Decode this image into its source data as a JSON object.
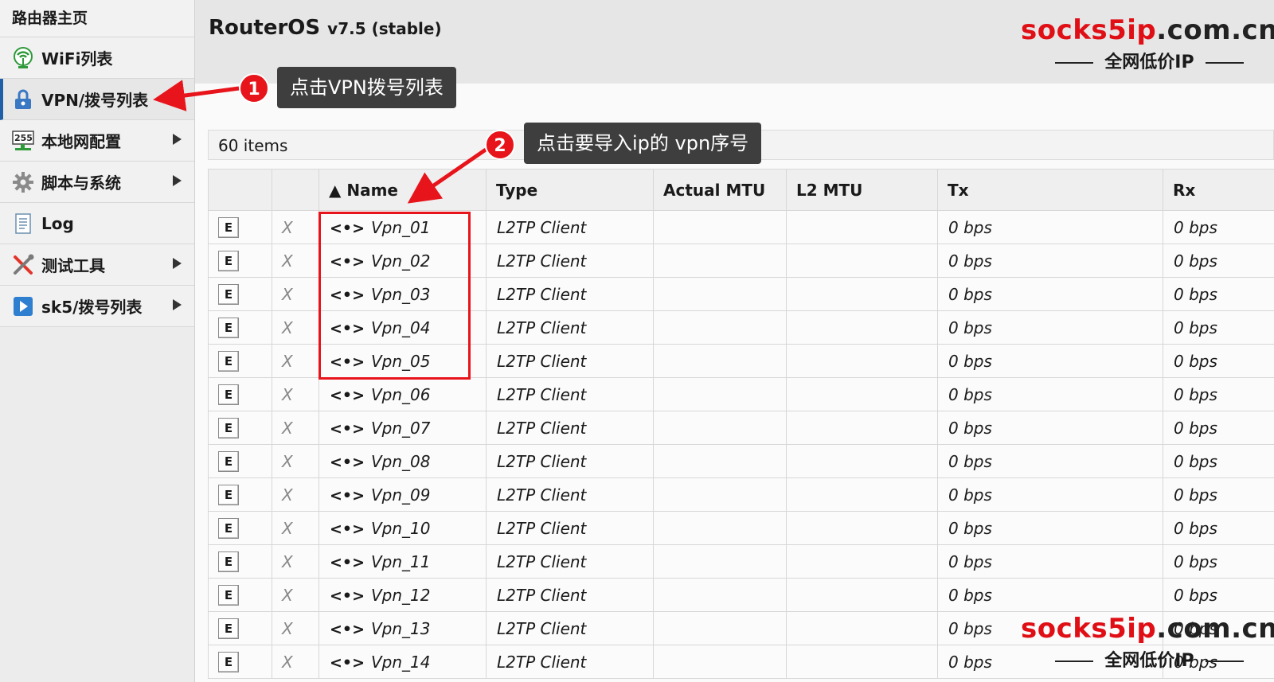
{
  "sidebar": {
    "home": "路由器主页",
    "items": [
      {
        "label": "WiFi列表",
        "icon": "wifi-icon",
        "active": false,
        "submenu": false
      },
      {
        "label": "VPN/拨号列表",
        "icon": "vpn-lock-icon",
        "active": true,
        "submenu": false
      },
      {
        "label": "本地网配置",
        "icon": "lan-255-icon",
        "active": false,
        "submenu": true
      },
      {
        "label": "脚本与系统",
        "icon": "gear-icon",
        "active": false,
        "submenu": true
      },
      {
        "label": "Log",
        "icon": "log-document-icon",
        "active": false,
        "submenu": false
      },
      {
        "label": "测试工具",
        "icon": "tools-icon",
        "active": false,
        "submenu": true
      },
      {
        "label": "sk5/拨号列表",
        "icon": "play-arrow-icon",
        "active": false,
        "submenu": true
      }
    ]
  },
  "header": {
    "product": "RouterOS",
    "version": "v7.5 (stable)"
  },
  "list": {
    "count_label": "60 items",
    "columns": [
      "",
      "",
      "▲ Name",
      "Type",
      "Actual MTU",
      "L2 MTU",
      "Tx",
      "Rx"
    ],
    "edit_label": "E",
    "disable_label": "X",
    "rows": [
      {
        "name": "Vpn_01",
        "type": "L2TP Client",
        "actual_mtu": "",
        "l2_mtu": "",
        "tx": "0 bps",
        "rx": "0 bps"
      },
      {
        "name": "Vpn_02",
        "type": "L2TP Client",
        "actual_mtu": "",
        "l2_mtu": "",
        "tx": "0 bps",
        "rx": "0 bps"
      },
      {
        "name": "Vpn_03",
        "type": "L2TP Client",
        "actual_mtu": "",
        "l2_mtu": "",
        "tx": "0 bps",
        "rx": "0 bps"
      },
      {
        "name": "Vpn_04",
        "type": "L2TP Client",
        "actual_mtu": "",
        "l2_mtu": "",
        "tx": "0 bps",
        "rx": "0 bps"
      },
      {
        "name": "Vpn_05",
        "type": "L2TP Client",
        "actual_mtu": "",
        "l2_mtu": "",
        "tx": "0 bps",
        "rx": "0 bps"
      },
      {
        "name": "Vpn_06",
        "type": "L2TP Client",
        "actual_mtu": "",
        "l2_mtu": "",
        "tx": "0 bps",
        "rx": "0 bps"
      },
      {
        "name": "Vpn_07",
        "type": "L2TP Client",
        "actual_mtu": "",
        "l2_mtu": "",
        "tx": "0 bps",
        "rx": "0 bps"
      },
      {
        "name": "Vpn_08",
        "type": "L2TP Client",
        "actual_mtu": "",
        "l2_mtu": "",
        "tx": "0 bps",
        "rx": "0 bps"
      },
      {
        "name": "Vpn_09",
        "type": "L2TP Client",
        "actual_mtu": "",
        "l2_mtu": "",
        "tx": "0 bps",
        "rx": "0 bps"
      },
      {
        "name": "Vpn_10",
        "type": "L2TP Client",
        "actual_mtu": "",
        "l2_mtu": "",
        "tx": "0 bps",
        "rx": "0 bps"
      },
      {
        "name": "Vpn_11",
        "type": "L2TP Client",
        "actual_mtu": "",
        "l2_mtu": "",
        "tx": "0 bps",
        "rx": "0 bps"
      },
      {
        "name": "Vpn_12",
        "type": "L2TP Client",
        "actual_mtu": "",
        "l2_mtu": "",
        "tx": "0 bps",
        "rx": "0 bps"
      },
      {
        "name": "Vpn_13",
        "type": "L2TP Client",
        "actual_mtu": "",
        "l2_mtu": "",
        "tx": "0 bps",
        "rx": "0 bps"
      },
      {
        "name": "Vpn_14",
        "type": "L2TP Client",
        "actual_mtu": "",
        "l2_mtu": "",
        "tx": "0 bps",
        "rx": "0 bps"
      }
    ]
  },
  "annotations": {
    "step1": {
      "number": "1",
      "text": "点击VPN拨号列表"
    },
    "step2": {
      "number": "2",
      "text": "点击要导入ip的 vpn序号"
    }
  },
  "watermark": {
    "brand": "socks5ip",
    "domain": ".com.cn",
    "tagline": "全网低价IP"
  },
  "colors": {
    "annotation_red": "#e8141b",
    "callout_bg": "#3e3e3e",
    "active_border": "#1e5fa8"
  }
}
